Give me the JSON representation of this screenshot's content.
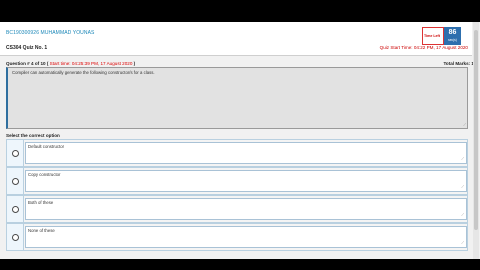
{
  "header": {
    "student_name": "BC190300926 MUHAMMAD YOUNAS",
    "time_left_label": "Time Left",
    "time_left_value": "86",
    "time_left_unit": "sec(s)",
    "quiz_no": "CS304 Quiz No. 1",
    "quiz_start_time": "Quiz Start Time: 04:22 PM,  17 August 2020"
  },
  "question": {
    "prefix": "Question # 4 of 10 ( ",
    "start_time": "Start time: 04:25:39 PM, 17 August 2020",
    "suffix": " )",
    "total_marks": "Total Marks: 1",
    "text": "Compiler can automatically generate the following constructor/s for a class."
  },
  "select_label": "Select the correct option",
  "options": [
    "Default constructor",
    "Copy constructor",
    "Both of these",
    "None of these"
  ],
  "colors": {
    "accent": "#2d6fae",
    "alert": "#cc0000",
    "name": "#1b87b8"
  }
}
